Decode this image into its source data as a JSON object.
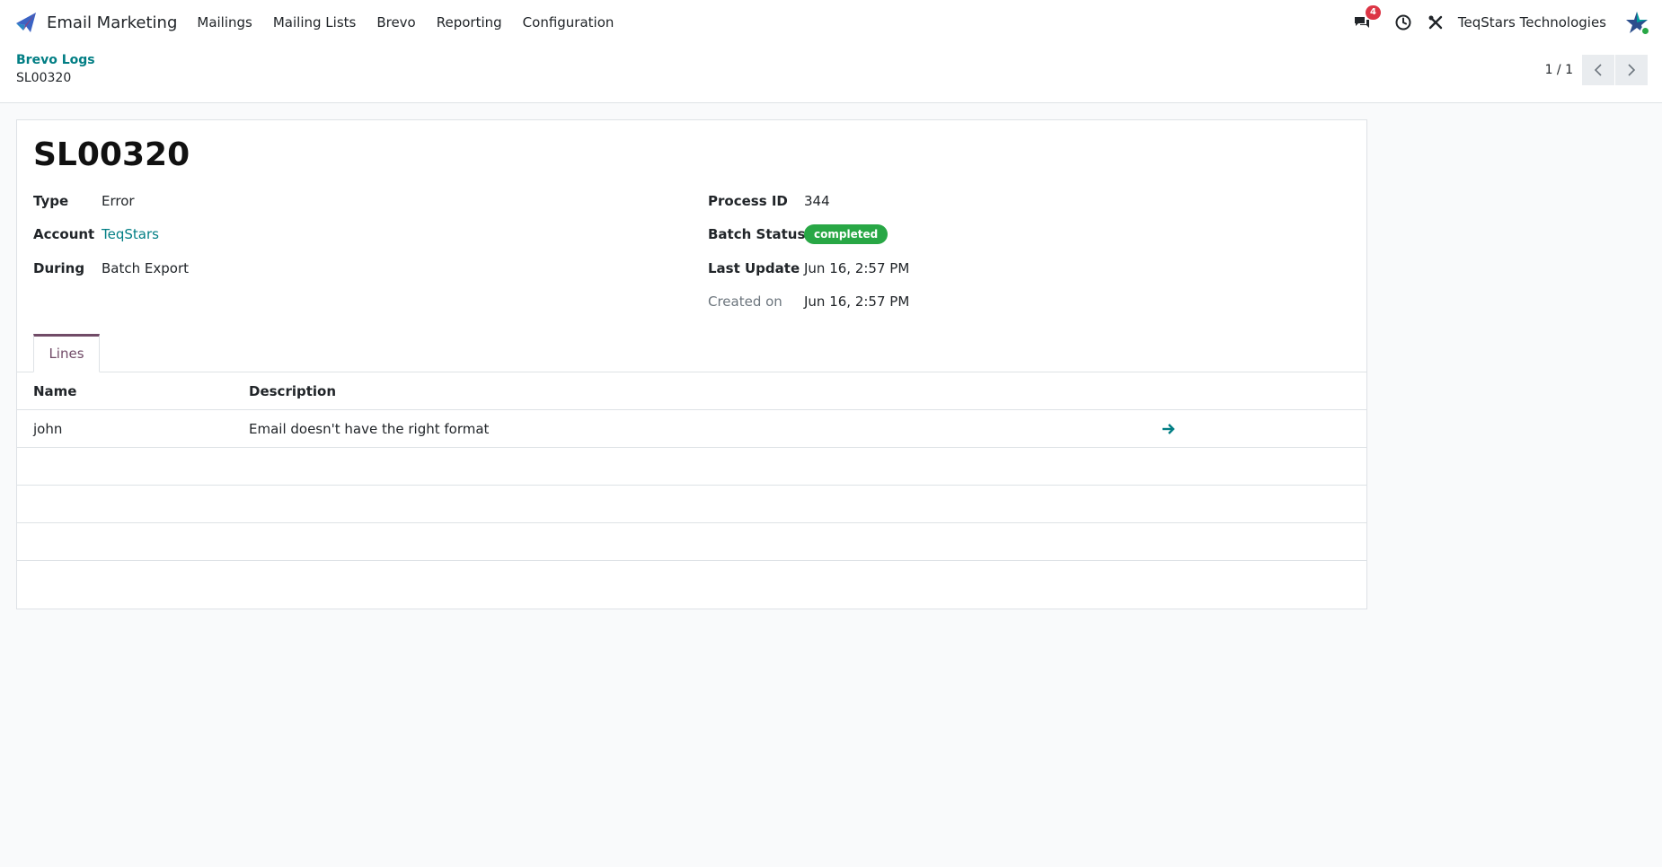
{
  "navbar": {
    "app_name": "Email Marketing",
    "menu": [
      "Mailings",
      "Mailing Lists",
      "Brevo",
      "Reporting",
      "Configuration"
    ],
    "messages_count": "4",
    "company": "TeqStars Technologies"
  },
  "control_panel": {
    "breadcrumb_parent": "Brevo Logs",
    "breadcrumb_current": "SL00320",
    "pager": "1 / 1"
  },
  "record": {
    "title": "SL00320",
    "left_fields": [
      {
        "label": "Type",
        "value": "Error"
      },
      {
        "label": "Account",
        "value": "TeqStars"
      },
      {
        "label": "During",
        "value": "Batch Export"
      }
    ],
    "right_fields": [
      {
        "label": "Process ID",
        "value": "344"
      },
      {
        "label": "Batch Status",
        "value": "completed"
      },
      {
        "label": "Last Update",
        "value": "Jun 16, 2:57 PM"
      },
      {
        "label": "Created on",
        "value": "Jun 16, 2:57 PM"
      }
    ]
  },
  "tabs": [
    "Lines"
  ],
  "lines": {
    "columns": [
      "Name",
      "Description"
    ],
    "rows": [
      {
        "name": "john",
        "description": "Email doesn't have the right format"
      }
    ]
  },
  "colors": {
    "brand": "#714b67",
    "link": "#017e84",
    "status_success": "#28a745",
    "badge_danger": "#dc3545"
  }
}
